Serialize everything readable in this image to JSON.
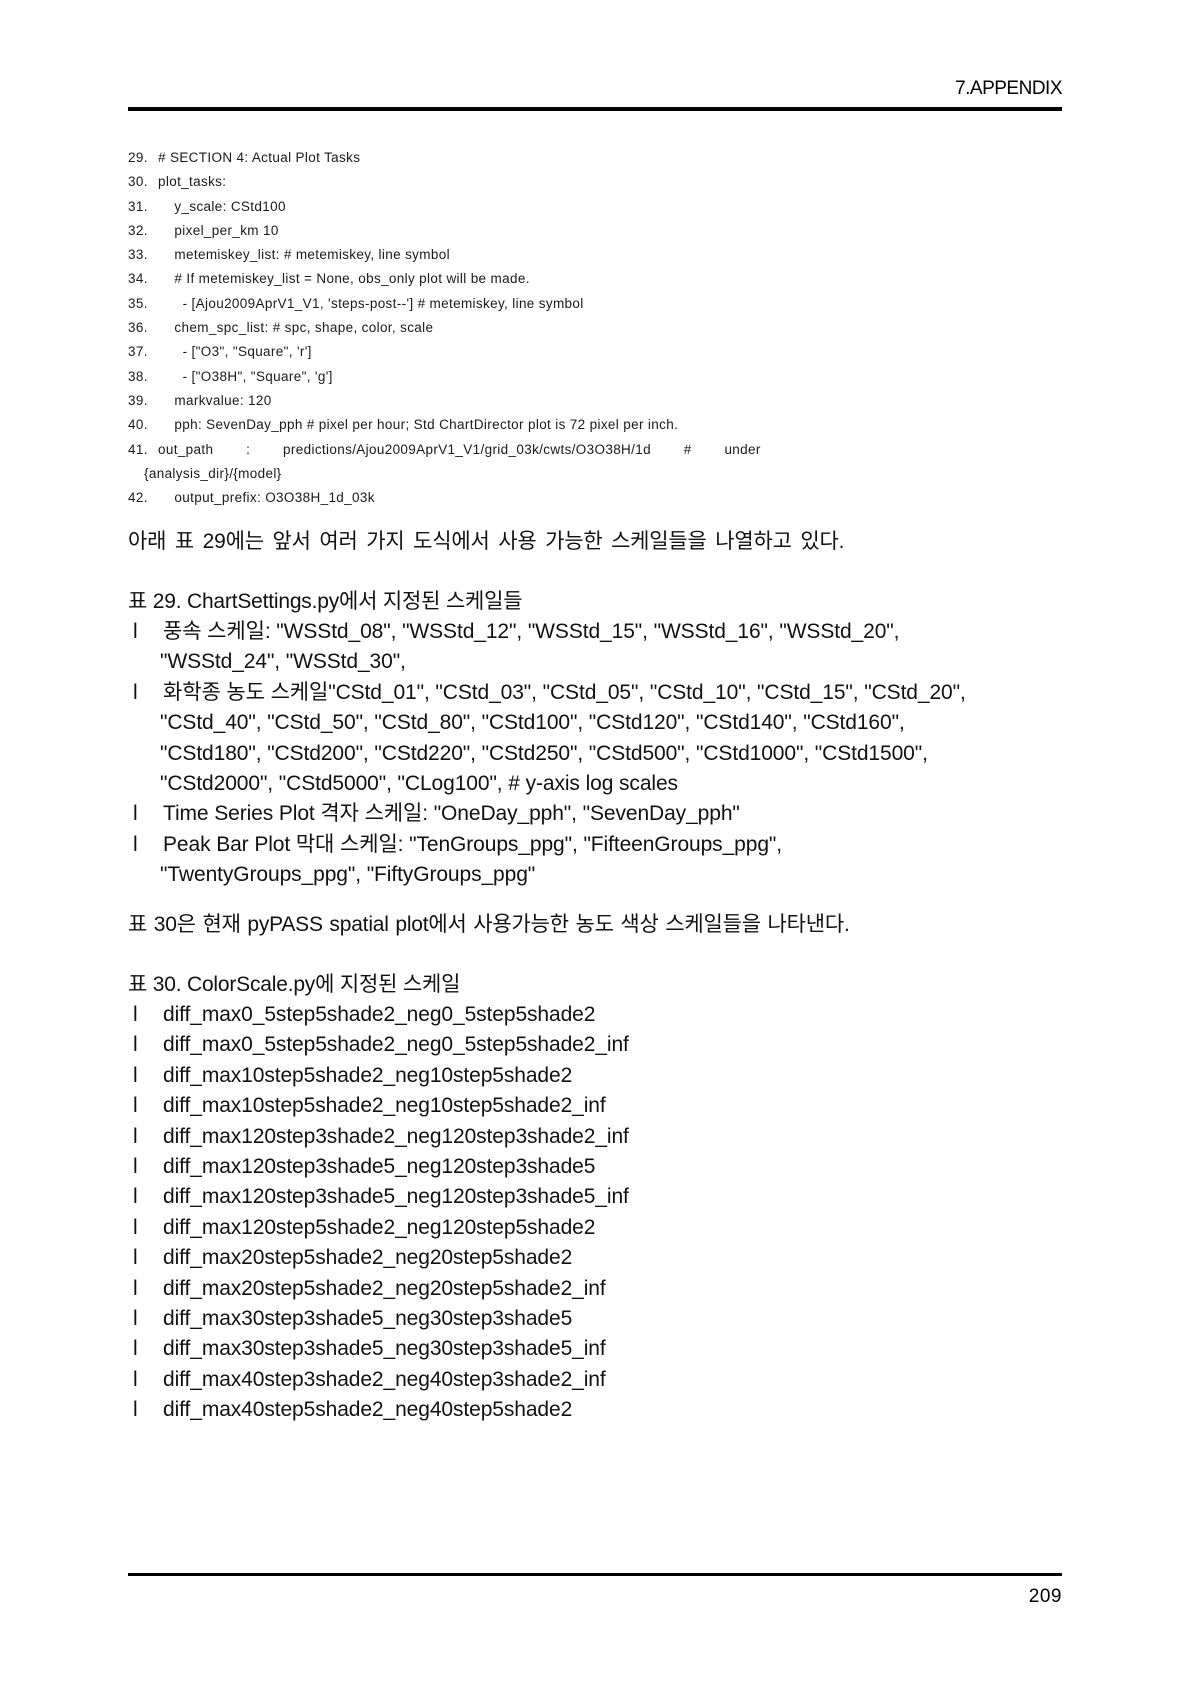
{
  "header": {
    "title": "7.APPENDIX"
  },
  "code": {
    "lines": [
      {
        "num": "29.",
        "text": "# SECTION 4: Actual Plot Tasks"
      },
      {
        "num": "30.",
        "text": "plot_tasks:"
      },
      {
        "num": "31.",
        "text": "    y_scale: CStd100"
      },
      {
        "num": "32.",
        "text": "    pixel_per_km 10"
      },
      {
        "num": "33.",
        "text": "    metemiskey_list: # metemiskey, line symbol"
      },
      {
        "num": "34.",
        "text": "    # If metemiskey_list = None, obs_only plot will be made."
      },
      {
        "num": "35.",
        "text": "      - [Ajou2009AprV1_V1, 'steps-post--'] # metemiskey, line symbol"
      },
      {
        "num": "36.",
        "text": "    chem_spc_list: # spc, shape, color, scale"
      },
      {
        "num": "37.",
        "text": "      - [\"O3\", \"Square\", 'r']"
      },
      {
        "num": "38.",
        "text": "      - [\"O38H\", \"Square\", 'g']"
      },
      {
        "num": "39.",
        "text": "    markvalue: 120"
      },
      {
        "num": "40.",
        "text": "    pph: SevenDay_pph # pixel per hour; Std ChartDirector plot is 72 pixel per inch."
      }
    ],
    "line41": {
      "num": "41.",
      "text_main": "out_path        :        predictions/Ajou2009AprV1_V1/grid_03k/cwts/O3O38H/1d        #        under",
      "text_cont": "{analysis_dir}/{model}"
    },
    "line42": {
      "num": "42.",
      "text": "    output_prefix: O3O38H_1d_03k"
    }
  },
  "body": {
    "intro_29": "아래 표 29에는 앞서 여러 가지 도식에서 사용 가능한 스케일들을 나열하고 있다.",
    "heading_29": "표 29. ChartSettings.py에서 지정된 스케일들",
    "intro_30": "표 30은 현재 pyPASS spatial plot에서 사용가능한 농도 색상 스케일들을 나타낸다.",
    "heading_30": "표 30. ColorScale.py에 지정된 스케일"
  },
  "bullets_29": [
    {
      "marker": "l",
      "lines": [
        "풍속   스케일:   \"WSStd_08\",   \"WSStd_12\",   \"WSStd_15\",   \"WSStd_16\",   \"WSStd_20\",",
        "\"WSStd_24\", \"WSStd_30\","
      ]
    },
    {
      "marker": "l",
      "lines": [
        "화학종 농도 스케일\"CStd_01\", \"CStd_03\", \"CStd_05\", \"CStd_10\", \"CStd_15\", \"CStd_20\",",
        "\"CStd_40\",   \"CStd_50\",   \"CStd_80\",   \"CStd100\",   \"CStd120\",   \"CStd140\",   \"CStd160\",",
        "\"CStd180\",   \"CStd200\",   \"CStd220\",   \"CStd250\",   \"CStd500\",   \"CStd1000\",   \"CStd1500\",",
        "\"CStd2000\", \"CStd5000\", \"CLog100\", # y-axis log scales"
      ]
    },
    {
      "marker": "l",
      "lines": [
        "Time Series Plot 격자 스케일: \"OneDay_pph\", \"SevenDay_pph\""
      ]
    },
    {
      "marker": "l",
      "lines": [
        "Peak      Bar      Plot      막대      스케일:      \"TenGroups_ppg\",      \"FifteenGroups_ppg\",",
        "\"TwentyGroups_ppg\", \"FiftyGroups_ppg\""
      ]
    }
  ],
  "bullets_30": [
    {
      "marker": "l",
      "label": "diff_max0_5step5shade2_neg0_5step5shade2"
    },
    {
      "marker": "l",
      "label": "diff_max0_5step5shade2_neg0_5step5shade2_inf"
    },
    {
      "marker": "l",
      "label": "diff_max10step5shade2_neg10step5shade2"
    },
    {
      "marker": "l",
      "label": "diff_max10step5shade2_neg10step5shade2_inf"
    },
    {
      "marker": "l",
      "label": "diff_max120step3shade2_neg120step3shade2_inf"
    },
    {
      "marker": "l",
      "label": "diff_max120step3shade5_neg120step3shade5"
    },
    {
      "marker": "l",
      "label": "diff_max120step3shade5_neg120step3shade5_inf"
    },
    {
      "marker": "l",
      "label": "diff_max120step5shade2_neg120step5shade2"
    },
    {
      "marker": "l",
      "label": "diff_max20step5shade2_neg20step5shade2"
    },
    {
      "marker": "l",
      "label": "diff_max20step5shade2_neg20step5shade2_inf"
    },
    {
      "marker": "l",
      "label": "diff_max30step3shade5_neg30step3shade5"
    },
    {
      "marker": "l",
      "label": "diff_max30step3shade5_neg30step3shade5_inf"
    },
    {
      "marker": "l",
      "label": "diff_max40step3shade2_neg40step3shade2_inf"
    },
    {
      "marker": "l",
      "label": "diff_max40step5shade2_neg40step5shade2"
    }
  ],
  "footer": {
    "page_number": "209"
  }
}
